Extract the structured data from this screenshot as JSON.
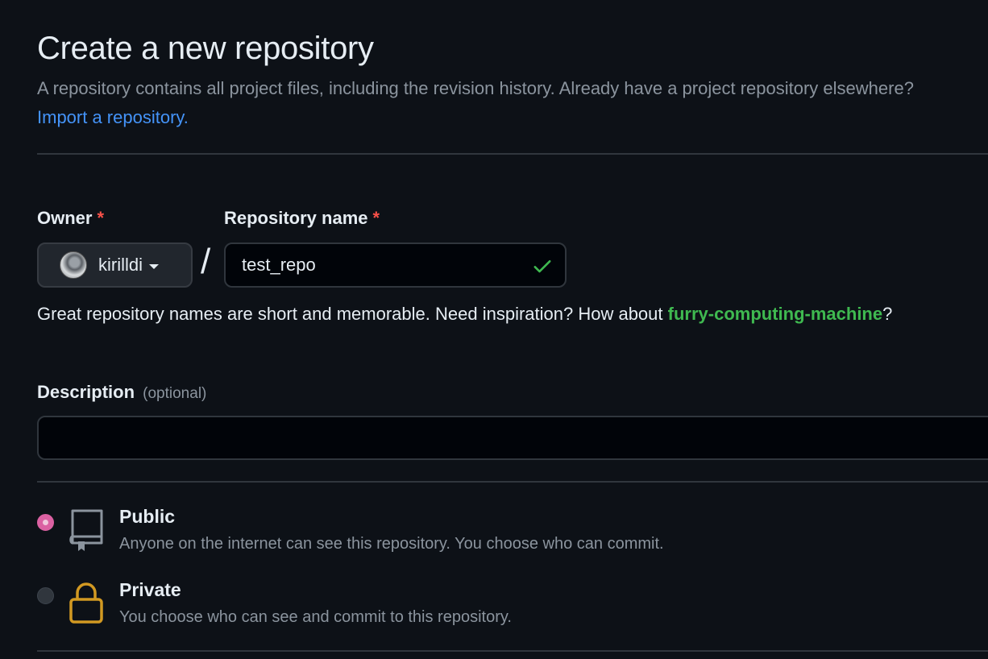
{
  "header": {
    "title": "Create a new repository",
    "subtitle": "A repository contains all project files, including the revision history. Already have a project repository elsewhere?",
    "import_link": "Import a repository."
  },
  "owner": {
    "label": "Owner",
    "required_mark": "*",
    "value": "kirilldi"
  },
  "separator": "/",
  "repo_name": {
    "label": "Repository name",
    "required_mark": "*",
    "value": "test_repo",
    "valid": true
  },
  "hint": {
    "text": "Great repository names are short and memorable. Need inspiration? How about",
    "suggestion": "furry-computing-machine",
    "end": "?"
  },
  "description": {
    "label": "Description",
    "optional": "(optional)",
    "value": ""
  },
  "visibility": {
    "selected": "public",
    "options": [
      {
        "id": "public",
        "title": "Public",
        "description": "Anyone on the internet can see this repository. You choose who can commit.",
        "icon": "repo-icon"
      },
      {
        "id": "private",
        "title": "Private",
        "description": "You choose who can see and commit to this repository.",
        "icon": "lock-icon"
      }
    ]
  },
  "colors": {
    "background": "#0d1117",
    "link": "#4493f8",
    "success": "#3fb950",
    "required": "#f85149",
    "radio_selected": "#db61a2",
    "lock": "#d29922"
  }
}
